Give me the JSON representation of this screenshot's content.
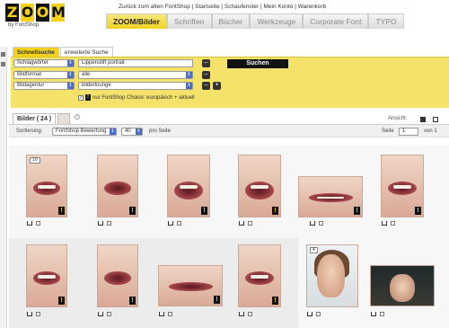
{
  "logo": {
    "letters": [
      "Z",
      "O",
      "O",
      "M"
    ],
    "byline": "by FontShop"
  },
  "top_links": "Zurück zum alten FontShop | Startseite | Schaufenster | Mein Konto | Warenkorb",
  "main_tabs": [
    {
      "label": "ZOOM/Bilder",
      "active": true
    },
    {
      "label": "Schriften",
      "active": false
    },
    {
      "label": "Bücher",
      "active": false
    },
    {
      "label": "Werkzeuge",
      "active": false
    },
    {
      "label": "Corporate Font",
      "active": false
    },
    {
      "label": "TYPO",
      "active": false
    }
  ],
  "search": {
    "tabs": [
      {
        "label": "Schnellsuche",
        "active": true
      },
      {
        "label": "erweiterte Suche",
        "active": false
      }
    ],
    "rows": [
      {
        "field": "Schlagwörter",
        "value": "Lippenstift portrait"
      },
      {
        "field": "Bildformat",
        "value": "alle"
      },
      {
        "field": "Bildagentur",
        "value": "bilderlounge"
      }
    ],
    "button_label": "Suchen",
    "choice_label": "nur FontShop Choice: europäisch + aktuell"
  },
  "results": {
    "tab_label": "Bilder ( 24 )",
    "view_label": "Ansicht:",
    "sort_label": "Sortierung:",
    "sort_value": "FontShop Bewertung",
    "per_page_value": "40",
    "per_page_label": "pro Seite",
    "page_label": "Seite",
    "page_value": "1",
    "page_of": "von 1"
  },
  "thumbnails": [
    {
      "badge": "10"
    },
    {
      "badge": ""
    },
    {
      "badge": ""
    },
    {
      "badge": ""
    },
    {
      "badge": ""
    },
    {
      "badge": ""
    },
    {
      "badge": ""
    },
    {
      "badge": ""
    },
    {
      "badge": ""
    },
    {
      "badge": ""
    },
    {
      "badge": "4"
    },
    {
      "badge": ""
    }
  ],
  "icons": {
    "badge_glyph": "!",
    "minus": "–",
    "plus": "+",
    "arrow": "⇕"
  },
  "colors": {
    "accent": "#f2d21a",
    "panel": "#f5e26a"
  }
}
